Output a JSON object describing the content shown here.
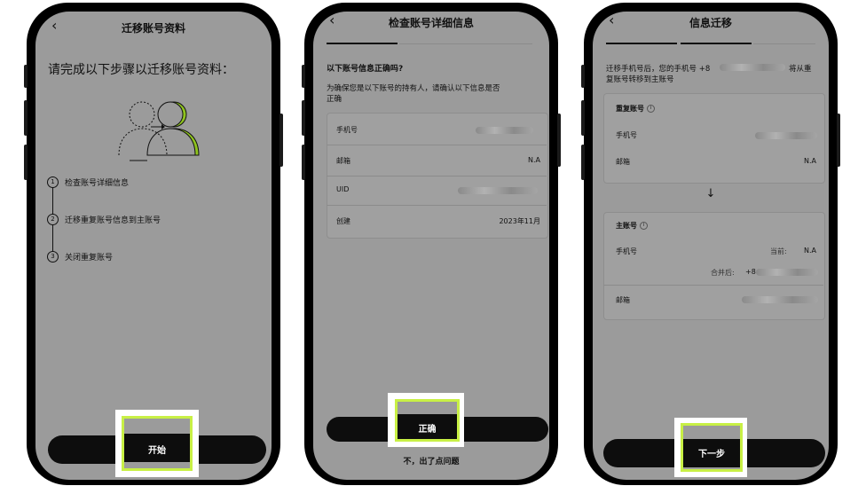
{
  "screen1": {
    "title": "迁移账号资料",
    "heading": "请完成以下步骤以迁移账号资料：",
    "steps": [
      {
        "num": "1",
        "label": "检查账号详细信息"
      },
      {
        "num": "2",
        "label": "迁移重复账号信息到主账号"
      },
      {
        "num": "3",
        "label": "关闭重复账号"
      }
    ],
    "start_button": "开始"
  },
  "screen2": {
    "title": "检查账号详细信息",
    "question": "以下账号信息正确吗?",
    "description_line1": "为确保您是以下账号的持有人，请确认以下信息是否",
    "description_line2": "正确",
    "rows": [
      {
        "label": "手机号",
        "value": ""
      },
      {
        "label": "邮箱",
        "value": "N.A"
      },
      {
        "label": "UID",
        "value": ""
      },
      {
        "label": "创建",
        "value": "2023年11月"
      }
    ],
    "confirm_button": "正确",
    "problem_link": "不，出了点问题"
  },
  "screen3": {
    "title": "信息迁移",
    "intro_line1_a": "迁移手机号后，您的手机号 +8",
    "intro_line1_b": "将从重",
    "intro_line2": "复账号转移到主账号",
    "duplicate": {
      "heading": "重复账号",
      "rows": [
        {
          "label": "手机号",
          "value": ""
        },
        {
          "label": "邮箱",
          "value": "N.A"
        }
      ]
    },
    "arrow": "↓",
    "main": {
      "heading": "主账号",
      "phone_label": "手机号",
      "current_label": "当前:",
      "current_value": "N.A",
      "merged_label": "合并后:",
      "merged_value": "+8",
      "email_label": "邮箱"
    },
    "next_button": "下一步"
  },
  "colors": {
    "highlight": "#c8f045",
    "accent_green": "#8fc31f",
    "screen_bg": "#9b9b9b",
    "button_bg": "#0d0d0d"
  }
}
